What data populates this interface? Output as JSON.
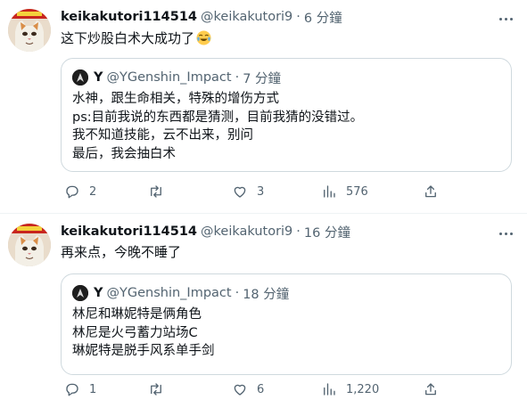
{
  "colors": {
    "text": "#0f1419",
    "secondary": "#536471",
    "border": "#cfd9de",
    "divider": "#eff3f4"
  },
  "tweets": [
    {
      "display_name": "keikakutori114514",
      "handle": "@keikakutori9",
      "sep": "·",
      "time": "6 分鐘",
      "text": "这下炒股白术大成功了",
      "emoji": "joy-emoji",
      "quote": {
        "name": "Y",
        "handle": "@YGenshin_Impact",
        "sep": "·",
        "time": "7 分鐘",
        "lines": [
          "水神，跟生命相关，特殊的增伤方式",
          "ps:目前我说的东西都是猜测，目前我猜的没错过。",
          "我不知道技能，云不出来，别问",
          "最后，我会抽白术"
        ]
      },
      "stats": {
        "replies": "2",
        "retweets": "",
        "likes": "3",
        "views": "576"
      }
    },
    {
      "display_name": "keikakutori114514",
      "handle": "@keikakutori9",
      "sep": "·",
      "time": "16 分鐘",
      "text": "再来点，今晚不睡了",
      "quote": {
        "name": "Y",
        "handle": "@YGenshin_Impact",
        "sep": "·",
        "time": "18 分鐘",
        "lines": [
          "林尼和琳妮特是俩角色",
          "林尼是火弓蓄力站场C",
          "琳妮特是脱手风系单手剑"
        ]
      },
      "stats": {
        "replies": "1",
        "retweets": "",
        "likes": "6",
        "views": "1,220"
      }
    }
  ]
}
